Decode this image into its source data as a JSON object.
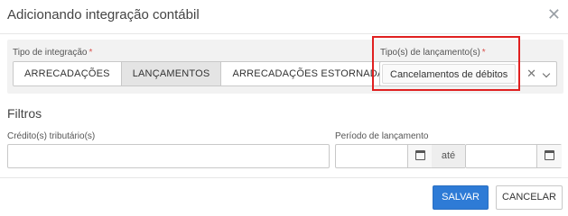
{
  "modal": {
    "title": "Adicionando integração contábil",
    "close_icon": "close-icon"
  },
  "integration": {
    "tipo_label": "Tipo de integração",
    "required_mark": "*",
    "options": [
      "ARRECADAÇÕES",
      "LANÇAMENTOS",
      "ARRECADAÇÕES ESTORNADAS"
    ],
    "selected_index": 1
  },
  "launch_type": {
    "label": "Tipo(s) de lançamento(s)",
    "required_mark": "*",
    "selected_chip": "Cancelamentos de débitos",
    "clear_icon": "clear-icon",
    "dropdown_icon": "chevron-down-icon"
  },
  "filters": {
    "title": "Filtros",
    "credit_label": "Crédito(s) tributário(s)",
    "credit_value": "",
    "period_label": "Período de lançamento",
    "period_start": "",
    "period_sep": "até",
    "period_end": "",
    "calendar_icon": "calendar-icon"
  },
  "actions": {
    "save_label": "SALVAR",
    "cancel_label": "CANCELAR"
  },
  "colors": {
    "primary": "#2e7bd6",
    "highlight": "#e02020",
    "required": "#d9534f"
  }
}
